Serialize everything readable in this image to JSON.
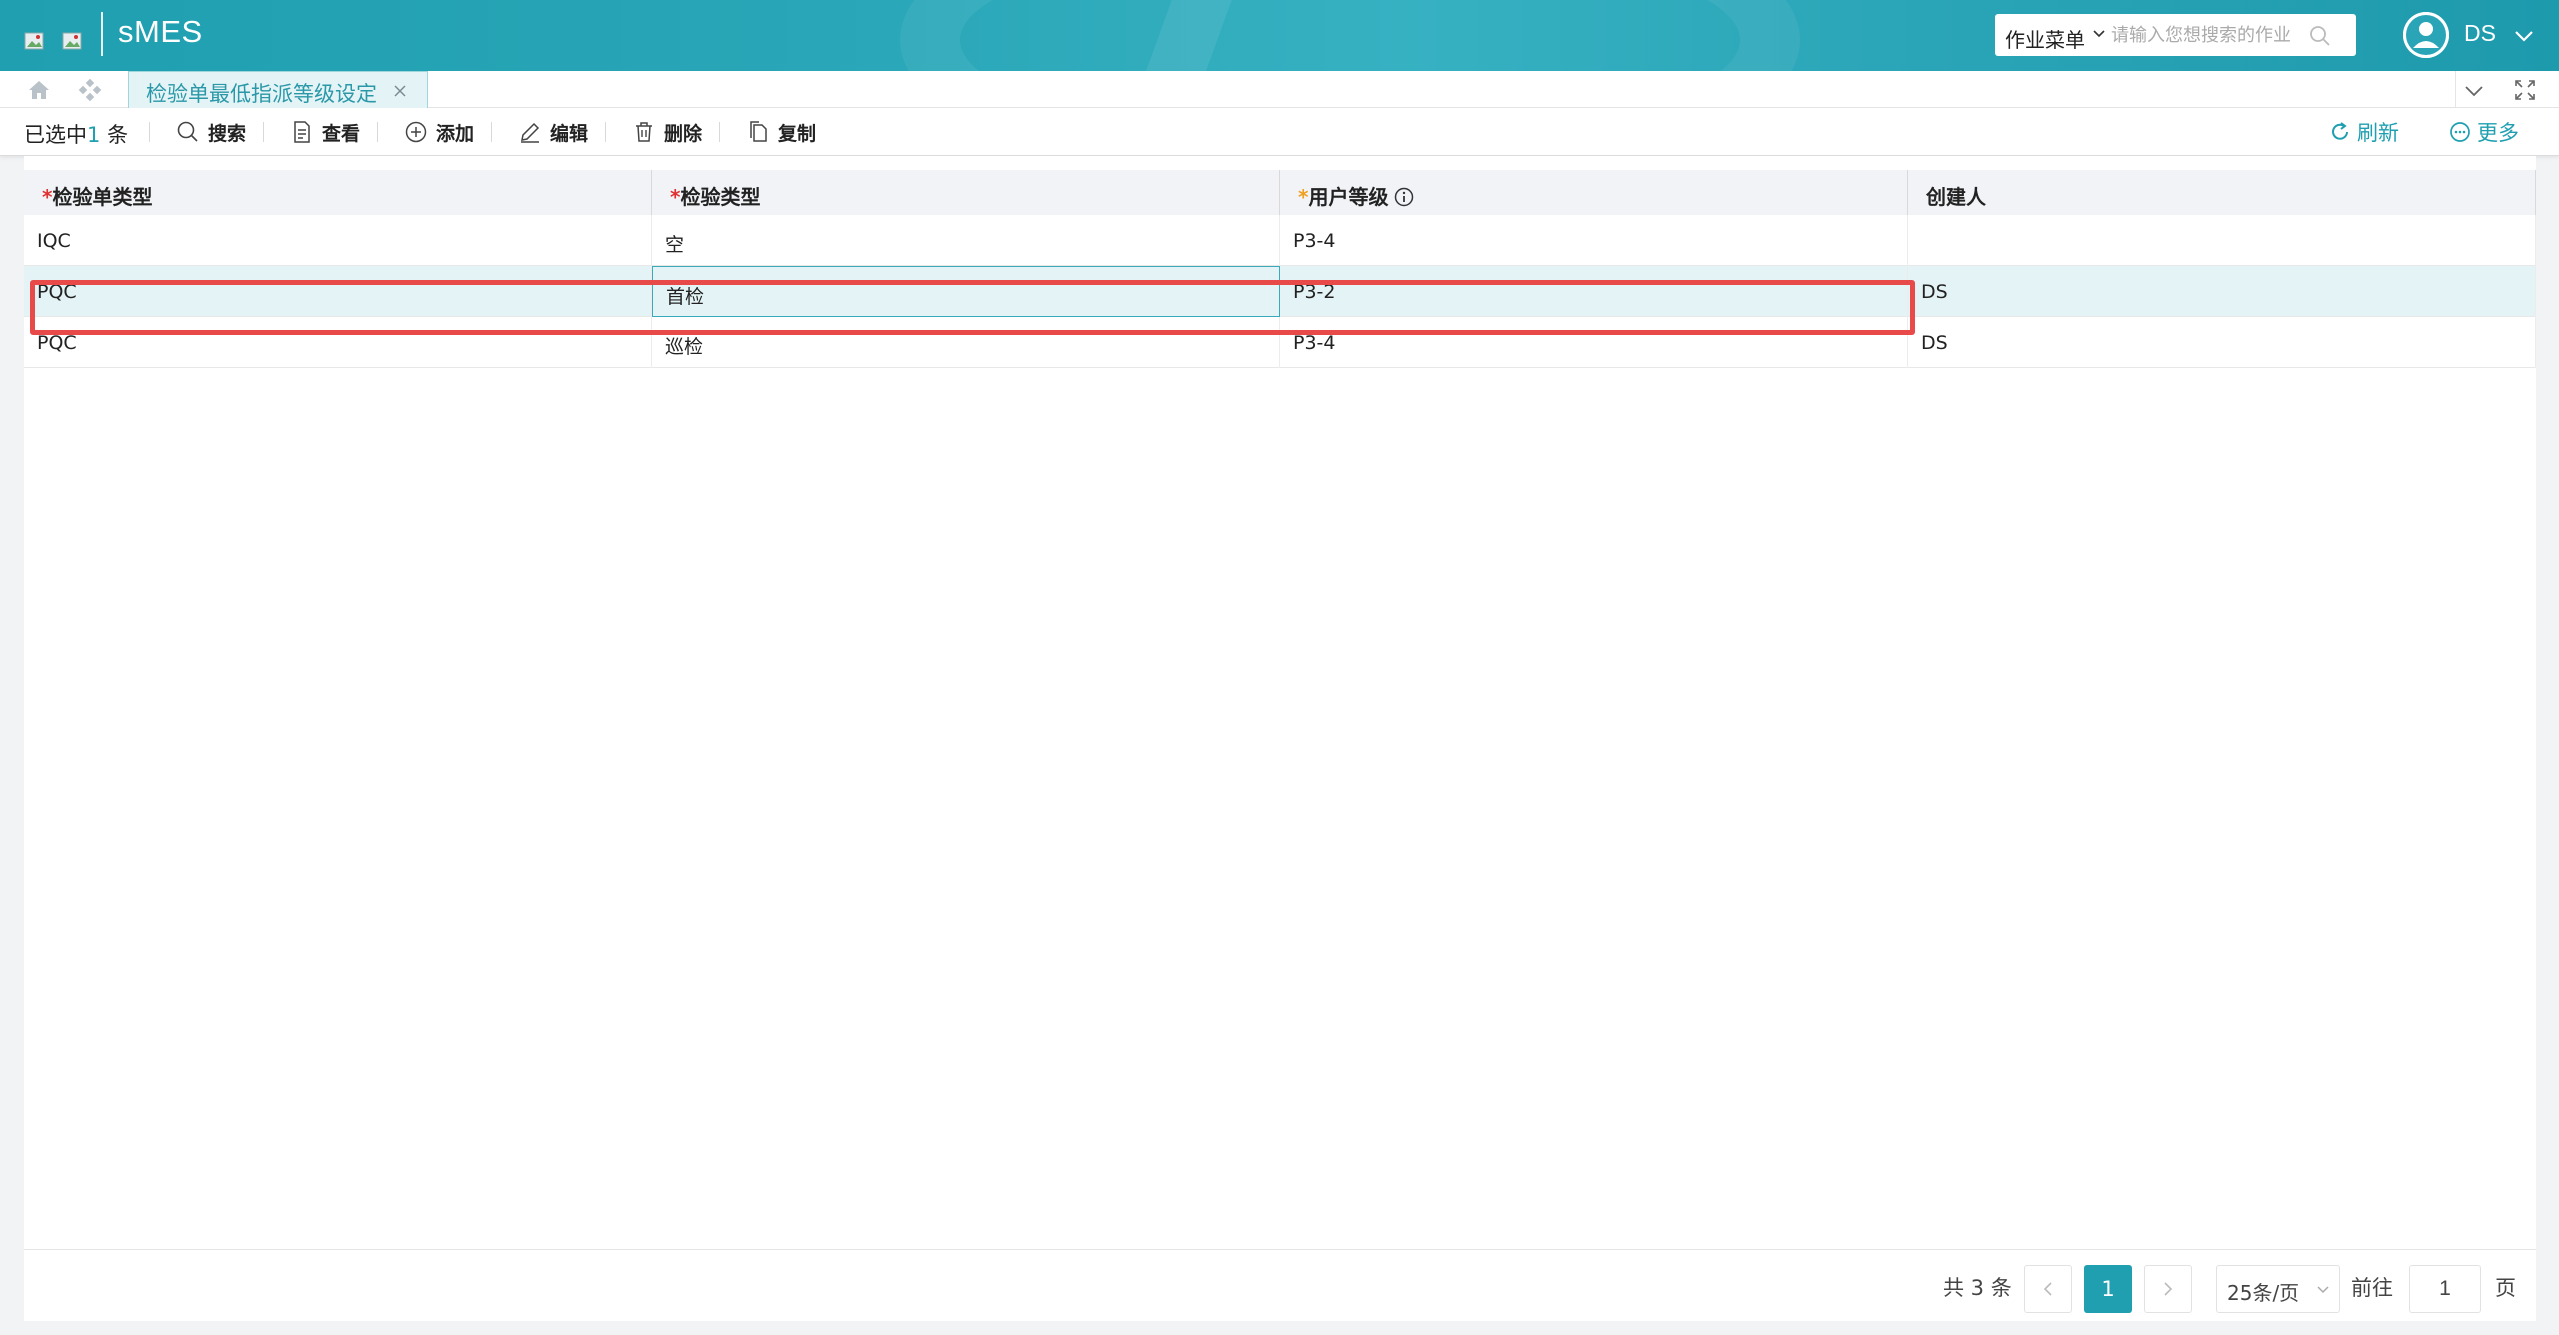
{
  "header": {
    "app_title": "sMES",
    "menu_select": "作业菜单",
    "search_placeholder": "请输入您想搜索的作业",
    "user_name": "DS"
  },
  "tabs": {
    "active_label": "检验单最低指派等级设定"
  },
  "toolbar": {
    "selected_prefix": "已选中",
    "selected_count": "1",
    "selected_suffix": "条",
    "search": "搜索",
    "view": "查看",
    "add": "添加",
    "edit": "编辑",
    "delete": "删除",
    "copy": "复制",
    "refresh": "刷新",
    "more": "更多"
  },
  "grid": {
    "columns": [
      {
        "label": "检验单类型",
        "required": "*"
      },
      {
        "label": "检验类型",
        "required": "*"
      },
      {
        "label": "用户等级",
        "required": "*"
      },
      {
        "label": "创建人",
        "required": ""
      }
    ],
    "rows": [
      [
        "IQC",
        "空",
        "P3-4",
        ""
      ],
      [
        "PQC",
        "首检",
        "P3-2",
        "DS"
      ],
      [
        "PQC",
        "巡检",
        "P3-4",
        "DS"
      ]
    ]
  },
  "pager": {
    "total": "共 3 条",
    "current_page": "1",
    "page_size": "25条/页",
    "goto_label": "前往",
    "goto_value": "1",
    "page_word": "页"
  },
  "colors": {
    "brand": "#1f9fb0",
    "selected_row": "#e4f4f6",
    "highlight": "#e84a4a"
  }
}
